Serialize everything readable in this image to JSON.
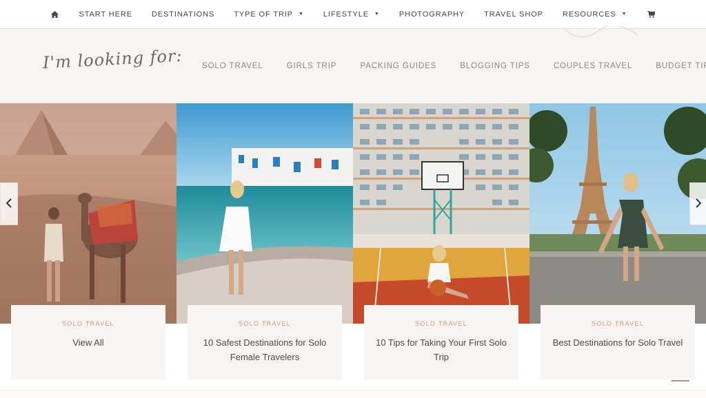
{
  "topnav": {
    "items": [
      {
        "label": "START HERE"
      },
      {
        "label": "DESTINATIONS"
      },
      {
        "label": "TYPE OF TRIP"
      },
      {
        "label": "LIFESTYLE"
      },
      {
        "label": "PHOTOGRAPHY"
      },
      {
        "label": "TRAVEL SHOP"
      },
      {
        "label": "RESOURCES"
      }
    ],
    "home_icon": "home-icon",
    "cart_icon": "cart-icon"
  },
  "looking": {
    "script_text": "I'm looking for:",
    "links": [
      "SOLO TRAVEL",
      "GIRLS TRIP",
      "PACKING GUIDES",
      "BLOGGING TIPS",
      "COUPLES TRAVEL",
      "BUDGET TIPS"
    ]
  },
  "cards": [
    {
      "category": "SOLO TRAVEL",
      "title": "View All"
    },
    {
      "category": "SOLO TRAVEL",
      "title": "10 Safest Destinations for Solo Female Travelers"
    },
    {
      "category": "SOLO TRAVEL",
      "title": "10 Tips for Taking Your First Solo Trip"
    },
    {
      "category": "SOLO TRAVEL",
      "title": "Best Destinations for Solo Travel"
    }
  ],
  "carousel": {
    "prev_icon": "chevron-left-icon",
    "next_icon": "chevron-right-icon"
  },
  "colors": {
    "category": "#c49b8b",
    "band": "#f7f5f2",
    "box": "#f8f4f1"
  }
}
